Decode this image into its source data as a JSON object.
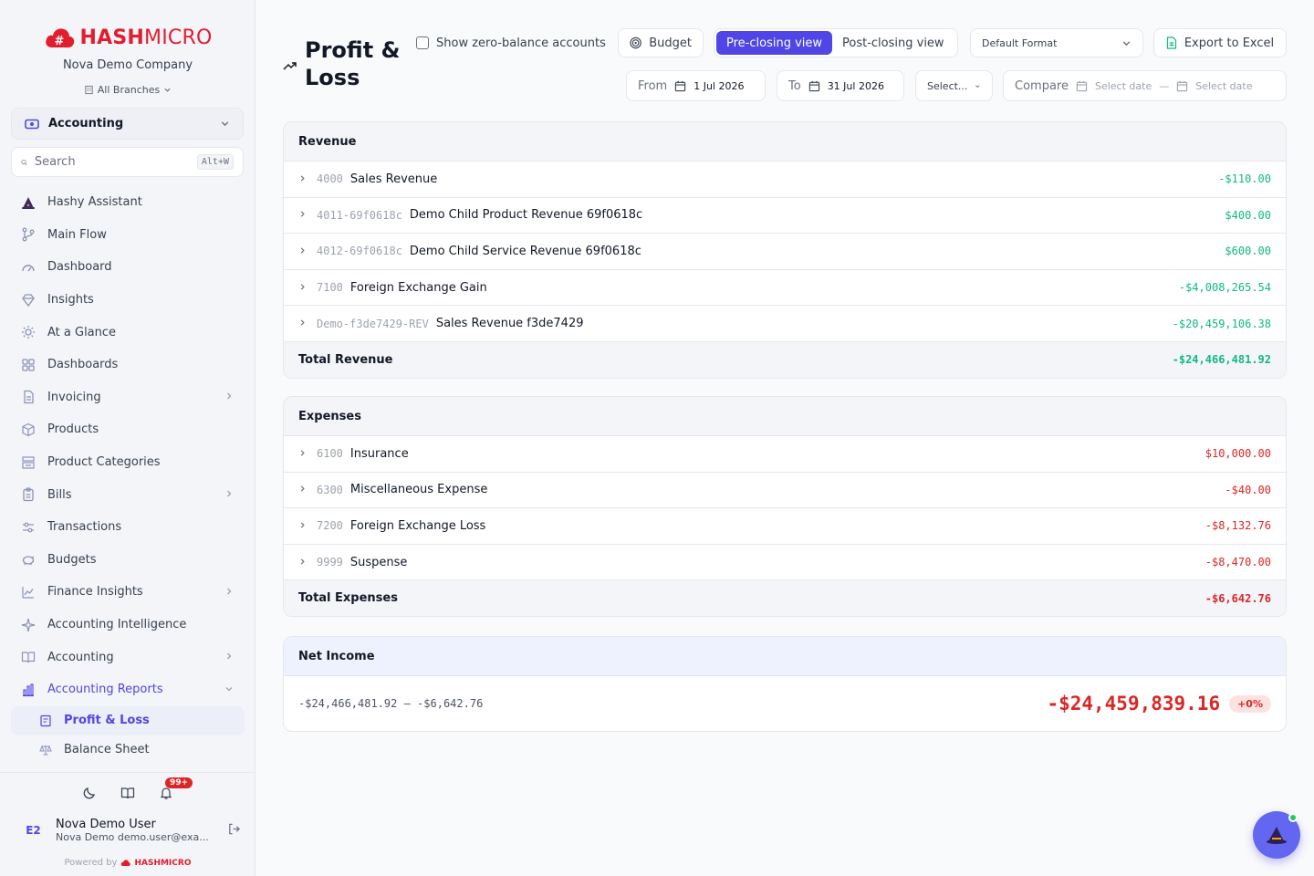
{
  "brand": {
    "name_bold": "HASH",
    "name_light": "MICRO",
    "company": "Nova Demo Company",
    "branches": "All Branches"
  },
  "module": {
    "label": "Accounting"
  },
  "search": {
    "placeholder": "Search",
    "shortcut": "Alt+W"
  },
  "nav": [
    {
      "label": "Hashy Assistant",
      "icon": "wizard-hat-icon"
    },
    {
      "label": "Main Flow",
      "icon": "flow-icon"
    },
    {
      "label": "Dashboard",
      "icon": "gauge-icon"
    },
    {
      "label": "Insights",
      "icon": "diamond-icon"
    },
    {
      "label": "At a Glance",
      "icon": "sun-icon"
    },
    {
      "label": "Dashboards",
      "icon": "grid-icon"
    },
    {
      "label": "Invoicing",
      "icon": "document-icon",
      "expandable": true
    },
    {
      "label": "Products",
      "icon": "box-icon"
    },
    {
      "label": "Product Categories",
      "icon": "categories-icon"
    },
    {
      "label": "Bills",
      "icon": "clipboard-icon",
      "expandable": true
    },
    {
      "label": "Transactions",
      "icon": "transactions-icon"
    },
    {
      "label": "Budgets",
      "icon": "piggy-bank-icon"
    },
    {
      "label": "Finance Insights",
      "icon": "trend-chart-icon",
      "expandable": true
    },
    {
      "label": "Accounting Intelligence",
      "icon": "sparkle-icon"
    },
    {
      "label": "Accounting",
      "icon": "book-icon",
      "expandable": true
    },
    {
      "label": "Accounting Reports",
      "icon": "bar-chart-icon",
      "expanded": true
    }
  ],
  "subnav": [
    {
      "label": "Profit & Loss",
      "icon": "report-icon",
      "active": true
    },
    {
      "label": "Balance Sheet",
      "icon": "scale-icon"
    }
  ],
  "utilities": {
    "notifications_badge": "99+"
  },
  "user": {
    "initials": "E2",
    "name": "Nova Demo User",
    "sub": "Nova Demo demo.user@exa..."
  },
  "powered": {
    "label": "Powered by",
    "brand": "HASHMICRO"
  },
  "page": {
    "title": "Profit & Loss"
  },
  "toolbar": {
    "zero_balance_label": "Show zero-balance accounts",
    "budget_label": "Budget",
    "pre_closing": "Pre-closing view",
    "post_closing": "Post-closing view",
    "format": "Default Format",
    "export": "Export to Excel",
    "from_label": "From",
    "from_value": "1 Jul 2026",
    "to_label": "To",
    "to_value": "31 Jul 2026",
    "period_select": "Select...",
    "compare_label": "Compare",
    "compare_start": "Select date",
    "compare_sep": "—",
    "compare_end": "Select date"
  },
  "revenue": {
    "title": "Revenue",
    "rows": [
      {
        "code": "4000",
        "name": "Sales Revenue",
        "amount": "-$110.00"
      },
      {
        "code": "4011-69f0618c",
        "name": "Demo Child Product Revenue 69f0618c",
        "amount": "$400.00"
      },
      {
        "code": "4012-69f0618c",
        "name": "Demo Child Service Revenue 69f0618c",
        "amount": "$600.00"
      },
      {
        "code": "7100",
        "name": "Foreign Exchange Gain",
        "amount": "-$4,008,265.54"
      },
      {
        "code": "Demo-f3de7429-REV",
        "name": "Sales Revenue f3de7429",
        "amount": "-$20,459,106.38"
      }
    ],
    "total_label": "Total Revenue",
    "total": "-$24,466,481.92"
  },
  "expenses": {
    "title": "Expenses",
    "rows": [
      {
        "code": "6100",
        "name": "Insurance",
        "amount": "$10,000.00"
      },
      {
        "code": "6300",
        "name": "Miscellaneous Expense",
        "amount": "-$40.00"
      },
      {
        "code": "7200",
        "name": "Foreign Exchange Loss",
        "amount": "-$8,132.76"
      },
      {
        "code": "9999",
        "name": "Suspense",
        "amount": "-$8,470.00"
      }
    ],
    "total_label": "Total Expenses",
    "total": "-$6,642.76"
  },
  "net_income": {
    "title": "Net Income",
    "formula": "-$24,466,481.92 — -$6,642.76",
    "value": "-$24,459,839.16",
    "change": "+0%"
  },
  "colors": {
    "accent": "#4f46e5",
    "positive": "#10b981",
    "negative": "#dc2626",
    "brand": "#e11d2e"
  }
}
